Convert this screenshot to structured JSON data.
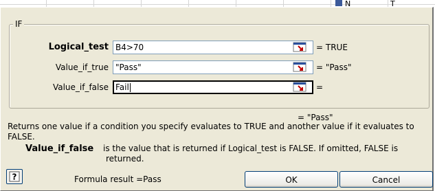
{
  "window": {
    "group_title": "IF",
    "background_peek": [
      "N",
      "T"
    ]
  },
  "arguments": [
    {
      "name": "Logical_test",
      "value": "B4>70",
      "result": "= TRUE",
      "required": true
    },
    {
      "name": "Value_if_true",
      "value": "\"Pass\"",
      "result": "= \"Pass\"",
      "required": false
    },
    {
      "name": "Value_if_false",
      "value": "Fail",
      "result": "=",
      "required": false
    }
  ],
  "function_result": "= \"Pass\"",
  "function_description": "Returns one value if a condition you specify evaluates to TRUE and another value if it evaluates to FALSE.",
  "argument_help": {
    "name": "Value_if_false",
    "text_line1": "is the value that is returned if Logical_test is FALSE. If omitted, FALSE is",
    "text_line2": "returned."
  },
  "footer": {
    "formula_result": "Formula result =Pass",
    "ok_label": "OK",
    "cancel_label": "Cancel",
    "help_icon": "help-question-icon"
  },
  "colors": {
    "dialog_bg": "#ece9d8",
    "input_border": "#7f9db9",
    "button_border": "#003c74"
  }
}
